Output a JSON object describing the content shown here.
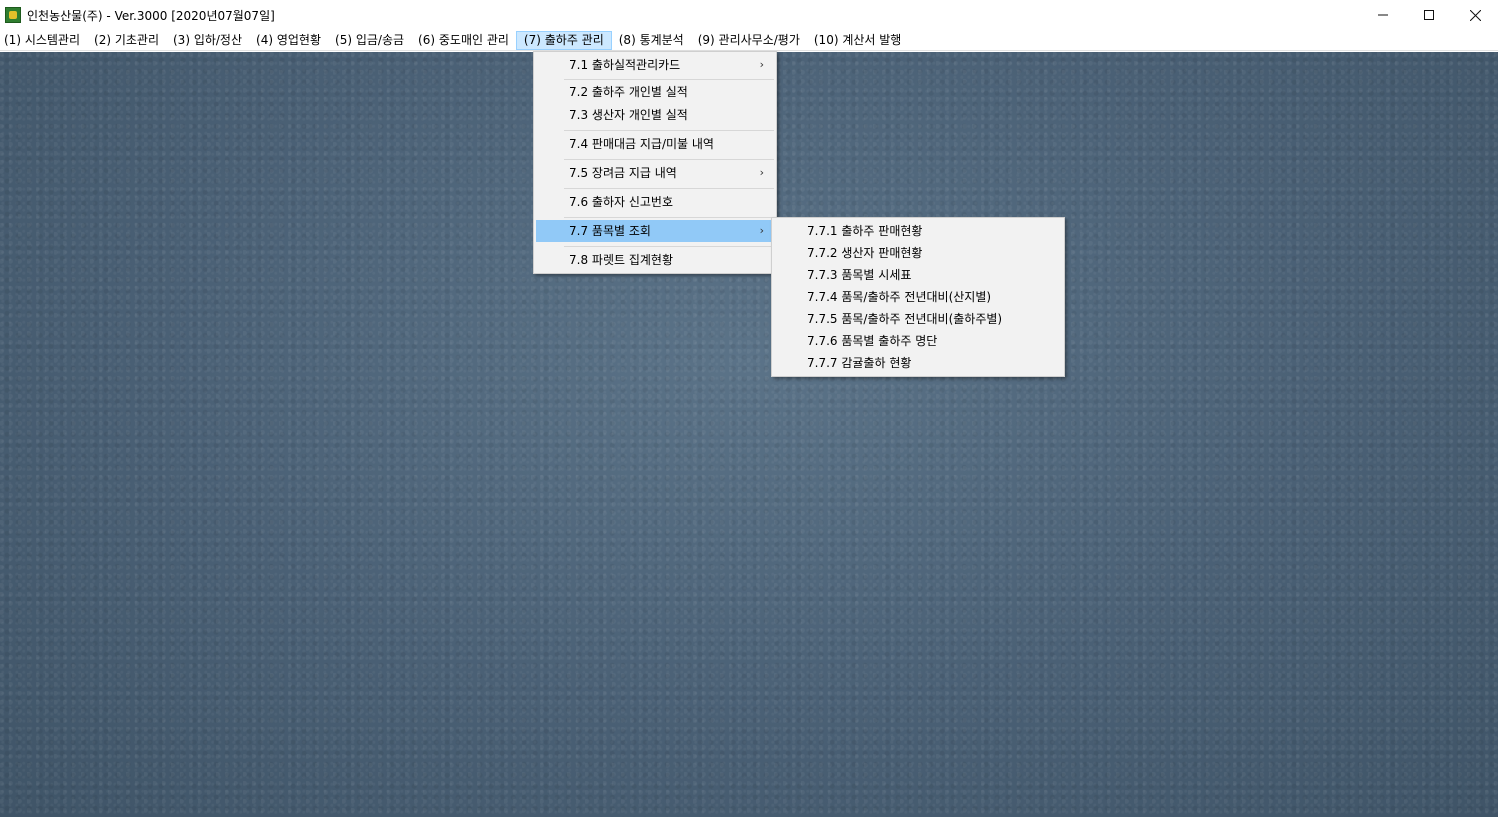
{
  "window": {
    "title": "인천농산물(주) - Ver.3000 [2020년07월07일]",
    "icon": "app-leaf-icon",
    "controls": [
      "minimize-icon",
      "maximize-icon",
      "close-icon"
    ]
  },
  "menubar": {
    "items": [
      {
        "label": "(1) 시스템관리"
      },
      {
        "label": "(2) 기초관리"
      },
      {
        "label": "(3) 입하/정산"
      },
      {
        "label": "(4) 영업현황"
      },
      {
        "label": "(5) 입금/송금"
      },
      {
        "label": "(6) 중도매인 관리"
      },
      {
        "label": "(7) 출하주 관리"
      },
      {
        "label": "(8) 통계분석"
      },
      {
        "label": "(9) 관리사무소/평가"
      },
      {
        "label": "(10) 계산서 발행"
      }
    ],
    "active_index": 6
  },
  "dropdown": {
    "items": [
      {
        "label": "7.1 출하실적관리카드",
        "arrow": "›"
      },
      {
        "label": "7.2 출하주 개인별 실적"
      },
      {
        "label": "7.3 생산자 개인별 실적"
      },
      {
        "label": "7.4 판매대금 지급/미불 내역"
      },
      {
        "label": "7.5 장려금 지급 내역",
        "arrow": "›"
      },
      {
        "label": "7.6 출하자 신고번호"
      },
      {
        "label": "7.7 품목별 조회",
        "arrow": "›"
      },
      {
        "label": "7.8 파렛트 집계현황"
      }
    ],
    "highlighted_index": 6
  },
  "submenu": {
    "items": [
      {
        "label": "7.7.1 출하주 판매현황"
      },
      {
        "label": "7.7.2 생산자 판매현황"
      },
      {
        "label": "7.7.3 품목별 시세표"
      },
      {
        "label": "7.7.4 품목/출하주 전년대비(산지별)"
      },
      {
        "label": "7.7.5 품목/출하주 전년대비(출하주별)"
      },
      {
        "label": "7.7.6 품목별 출하주 명단"
      },
      {
        "label": "7.7.7 감귤출하 현황"
      }
    ]
  },
  "colors": {
    "desktop": "#4d6478",
    "menu_highlight": "#91c9f7",
    "menubar_active": "#cce8ff"
  }
}
